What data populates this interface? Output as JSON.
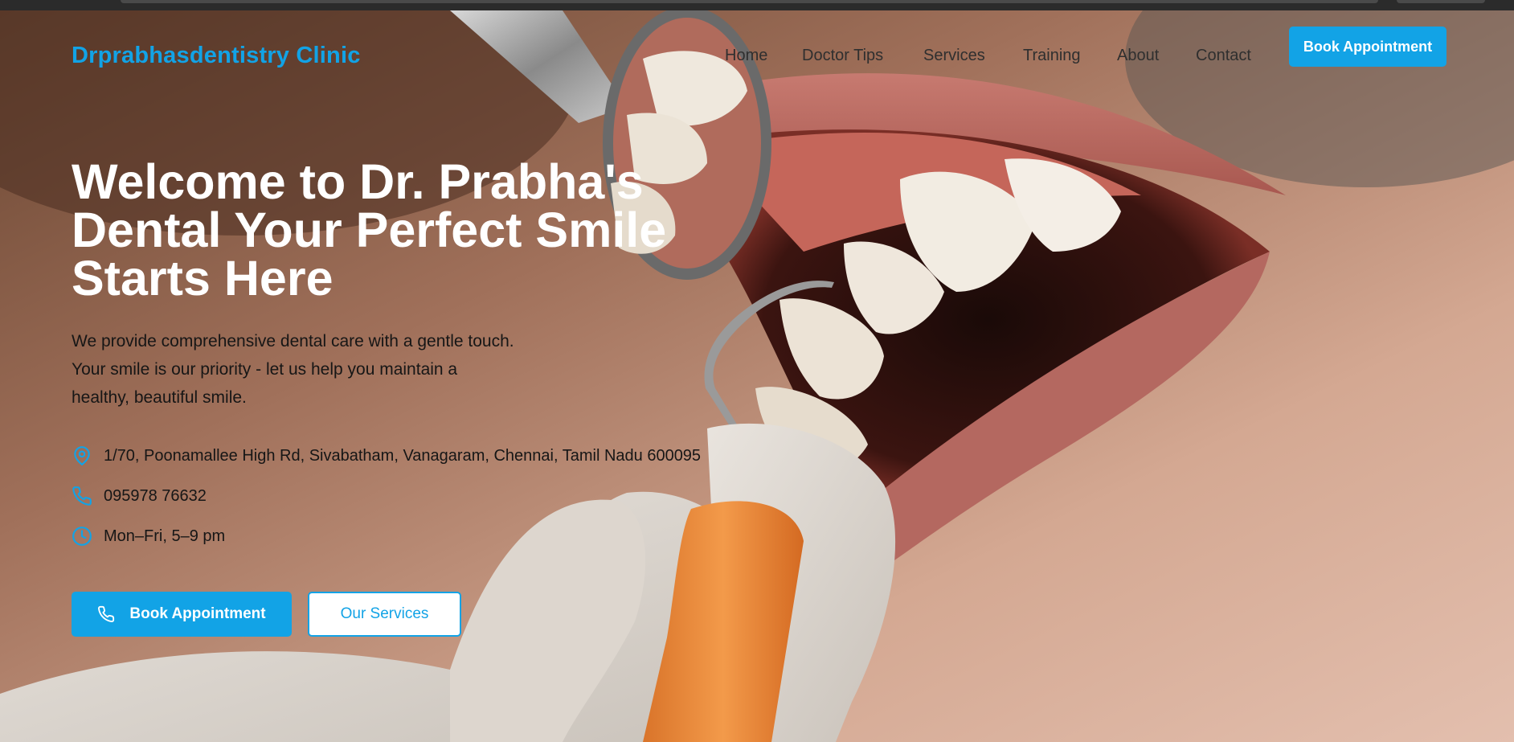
{
  "header": {
    "brand": "Drprabhasdentistry Clinic",
    "nav": [
      {
        "label": "Home"
      },
      {
        "label": "Doctor Tips"
      },
      {
        "label": "Services"
      },
      {
        "label": "Training"
      },
      {
        "label": "About"
      },
      {
        "label": "Contact"
      }
    ],
    "cta_label": "Book Appointment"
  },
  "hero": {
    "title_line1": "Welcome to Dr. Prabha's",
    "title_line2": "Dental Your Perfect Smile",
    "title_line3": "Starts Here",
    "desc_line1": "We provide comprehensive dental care with a gentle touch.",
    "desc_line2": "Your smile is our priority - let us help you maintain a",
    "desc_line3": "healthy, beautiful smile.",
    "address": "1/70, Poonamallee High Rd, Sivabatham, Vanagaram, Chennai, Tamil Nadu 600095",
    "phone": "095978 76632",
    "hours": "Mon–Fri, 5–9 pm",
    "primary_button": "Book Appointment",
    "secondary_button": "Our Services",
    "icons": [
      "location-pin-icon",
      "phone-icon",
      "clock-icon",
      "phone-icon"
    ]
  },
  "colors": {
    "accent": "#12a3e6",
    "heading": "#ffffff",
    "text": "#161616"
  }
}
